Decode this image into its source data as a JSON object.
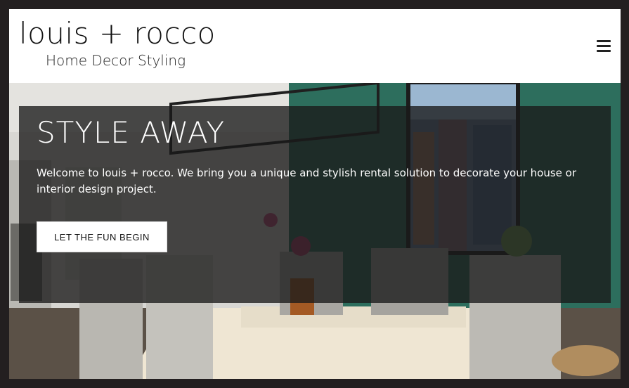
{
  "header": {
    "logo_title": "louis + rocco",
    "logo_subtitle": "Home Decor Styling",
    "menu_icon": "hamburger-menu-icon"
  },
  "hero": {
    "title": "STYLE AWAY",
    "text": "Welcome to louis + rocco. We bring you a unique and stylish rental solution to decorate your house or interior design project.",
    "cta_label": "LET THE FUN BEGIN"
  },
  "colors": {
    "frame": "#231f20",
    "accent_wall": "#2e6f5e",
    "overlay": "rgba(25,25,25,0.78)",
    "text_light": "#ffffff"
  }
}
